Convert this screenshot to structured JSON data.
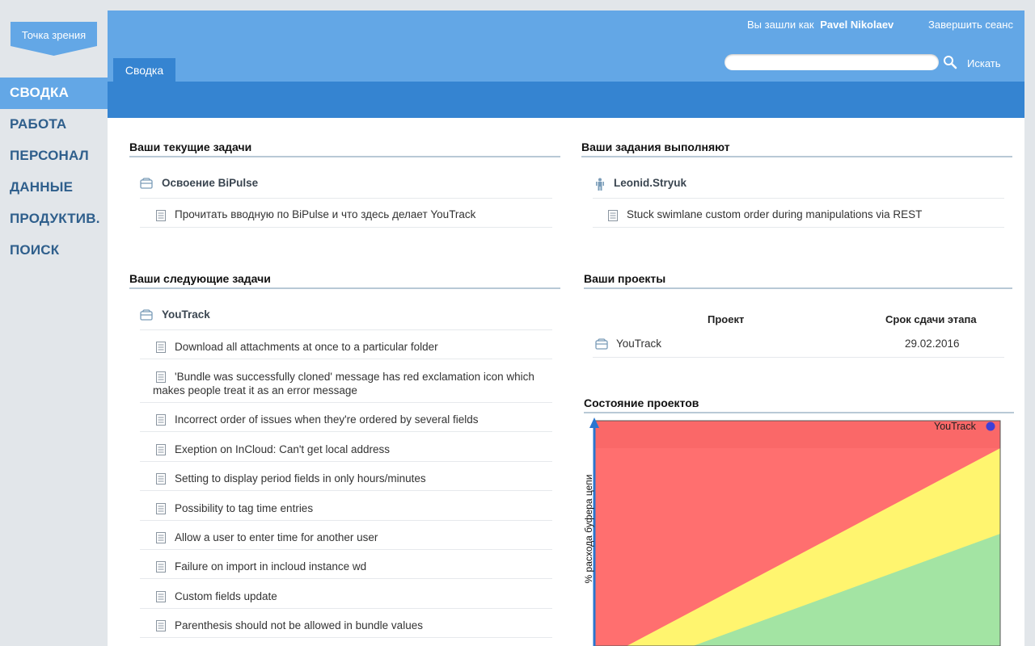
{
  "logo": {
    "label": "Точка зрения"
  },
  "nav": {
    "items": [
      {
        "label": "СВОДКА",
        "active": true
      },
      {
        "label": "РАБОТА"
      },
      {
        "label": "ПЕРСОНАЛ"
      },
      {
        "label": "ДАННЫЕ"
      },
      {
        "label": "ПРОДУКТИВ."
      },
      {
        "label": "ПОИСК"
      }
    ]
  },
  "header": {
    "logged_in_prefix": "Вы зашли как",
    "user_name": "Pavel Nikolaev",
    "logout_label": "Завершить сеанс",
    "tab_label": "Сводка",
    "search": {
      "placeholder": "",
      "value": "",
      "button_label": "Искать"
    }
  },
  "current_tasks": {
    "title": "Ваши текущие задачи",
    "project": "Освоение BiPulse",
    "items": [
      "Прочитать вводную по BiPulse и что здесь делает YouTrack"
    ]
  },
  "assigned_to_others": {
    "title": "Ваши задания выполняют",
    "person": "Leonid.Stryuk",
    "items": [
      "Stuck swimlane custom order during manipulations via REST"
    ]
  },
  "next_tasks": {
    "title": "Ваши следующие задачи",
    "project": "YouTrack",
    "items": [
      "Download all attachments at once to a particular folder",
      "'Bundle was successfully cloned' message has red exclamation icon which",
      "makes people treat it as an error message",
      "Incorrect order of issues when they're ordered by several fields",
      "Exeption on InCloud: Can't get local address",
      "Setting to display period fields in only hours/minutes",
      "Possibility to tag time entries",
      "Allow a user to enter time for another user",
      "Failure on import in incloud instance wd",
      "Custom fields update",
      "Parenthesis should not be allowed in bundle values"
    ]
  },
  "projects": {
    "title": "Ваши проекты",
    "columns": [
      "Проект",
      "Срок сдачи этапа"
    ],
    "rows": [
      {
        "project": "YouTrack",
        "deadline": "29.02.2016"
      }
    ]
  },
  "project_status": {
    "title": "Состояние проектов"
  },
  "chart_data": {
    "type": "scatter",
    "title": "Состояние проектов",
    "ylabel": "% расхода буфера цепи",
    "xlabel": "",
    "zones": [
      "green",
      "yellow",
      "red"
    ],
    "zone_colors": {
      "red": "#ff6f6f",
      "yellow": "#fff56f",
      "green": "#a3e4a3"
    },
    "series": [
      {
        "name": "YouTrack",
        "color": "#3f3fd6"
      }
    ]
  }
}
